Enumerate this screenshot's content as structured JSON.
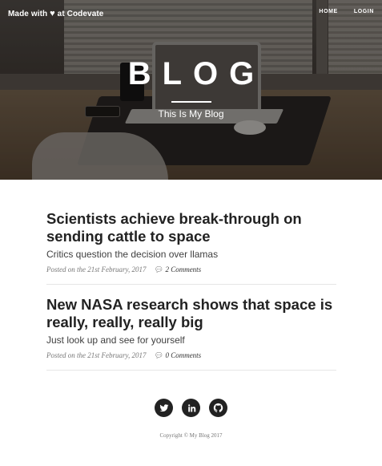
{
  "nav": {
    "brand_prefix": "Made with",
    "brand_suffix": "at Codevate",
    "links": [
      "HOME",
      "LOGIN"
    ]
  },
  "hero": {
    "title": "BLOG",
    "subtitle": "This Is My Blog"
  },
  "posts": [
    {
      "title": "Scientists achieve break-through on sending cattle to space",
      "subtitle": "Critics question the decision over llamas",
      "posted": "Posted on the 21st February, 2017",
      "comments": "2 Comments"
    },
    {
      "title": "New NASA research shows that space is really, really, really big",
      "subtitle": "Just look up and see for yourself",
      "posted": "Posted on the 21st February, 2017",
      "comments": "0 Comments"
    }
  ],
  "footer": {
    "social_icons": [
      "twitter-icon",
      "linkedin-icon",
      "github-icon"
    ],
    "copyright": "Copyright © My Blog 2017"
  },
  "colors": {
    "heading": "#222222",
    "muted": "#777777",
    "icon_bg": "#222222"
  }
}
